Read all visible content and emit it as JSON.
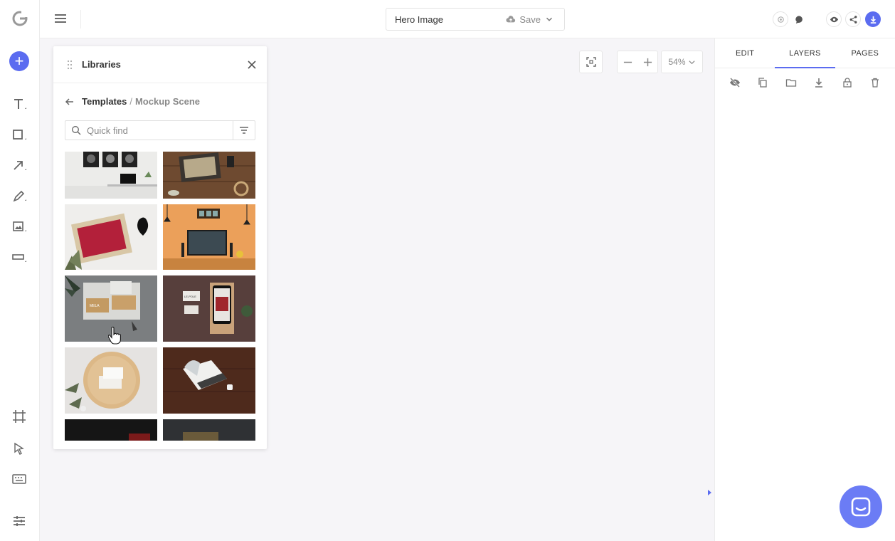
{
  "app": {
    "logo": "G"
  },
  "toolbar": {
    "doc_title": "Hero Image",
    "save_label": "Save"
  },
  "canvas": {
    "zoom": "54%"
  },
  "libraries": {
    "title": "Libraries",
    "breadcrumb": {
      "root": "Templates",
      "separator": "/",
      "current": "Mockup Scene"
    },
    "search_placeholder": "Quick find",
    "business_card_text": "MELA",
    "phone_brand_text": "LE-POLE"
  },
  "right_panel": {
    "tabs": [
      {
        "label": "EDIT"
      },
      {
        "label": "LAYERS"
      },
      {
        "label": "PAGES"
      }
    ],
    "active_tab": "LAYERS"
  },
  "colors": {
    "accent": "#5b6cf0",
    "chat": "#6b7cf5"
  }
}
